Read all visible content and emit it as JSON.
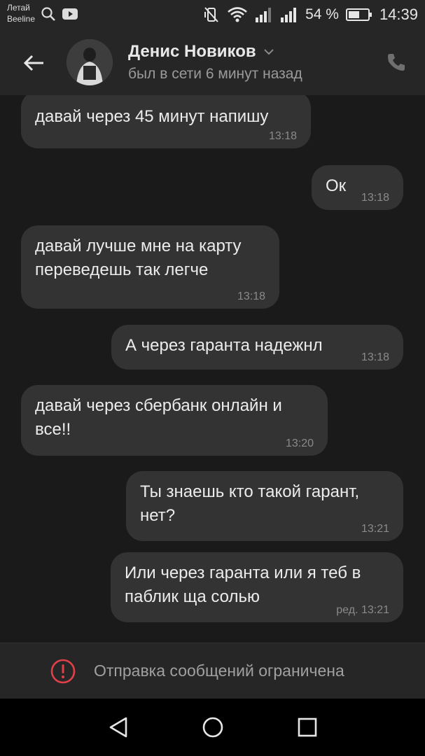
{
  "status_bar": {
    "carrier_line1": "Летай",
    "carrier_line2": "Beeline",
    "battery_percent": "54 %",
    "time": "14:39"
  },
  "header": {
    "contact_name": "Денис Новиков",
    "last_seen": "был в сети 6 минут назад"
  },
  "messages": [
    {
      "side": "in",
      "text": "давай через 45 минут напишу",
      "time": "13:18"
    },
    {
      "side": "out",
      "text": "Ок",
      "time": "13:18"
    },
    {
      "side": "in",
      "text": "давай лучше мне на карту\nпереведешь так легче",
      "time": "13:18"
    },
    {
      "side": "out",
      "text": "А через гаранта надежнл",
      "time": "13:18"
    },
    {
      "side": "in",
      "text": "давай через сбербанк онлайн и\nвсе!!",
      "time": "13:20"
    },
    {
      "side": "out",
      "text": "Ты знаешь кто такой гарант,\nнет?",
      "time": "13:21"
    },
    {
      "side": "out",
      "text": "Или через гаранта или я теб в\nпаблик ща солью",
      "time": "ред. 13:21"
    }
  ],
  "restricted_notice": "Отправка сообщений ограничена",
  "icons": {
    "back": "arrow-left-icon",
    "call": "phone-icon",
    "warning": "exclamation-circle-icon",
    "nav_back": "triangle-back-icon",
    "nav_home": "circle-home-icon",
    "nav_recent": "square-recent-icon"
  },
  "colors": {
    "background": "#1a1a1a",
    "bar": "#262626",
    "bubble": "#333333",
    "warning": "#e0404a"
  }
}
